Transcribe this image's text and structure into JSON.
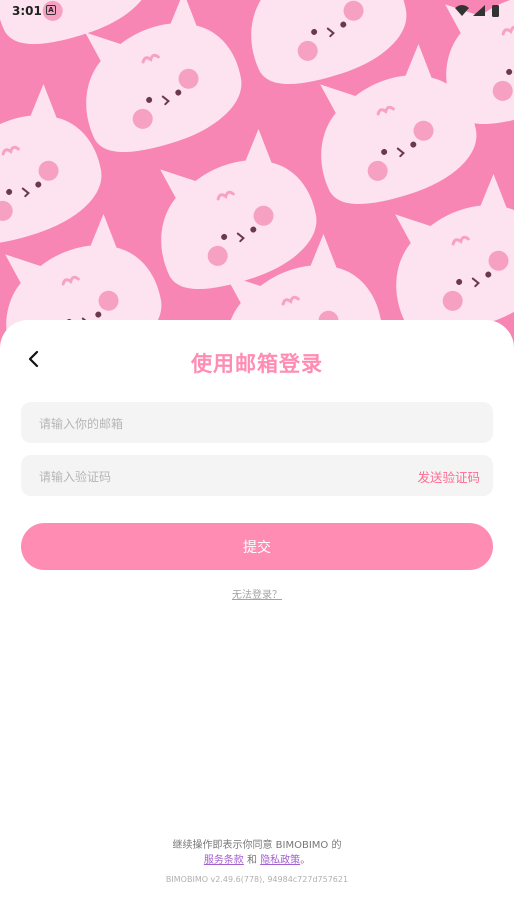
{
  "status_bar": {
    "time": "3:01",
    "notification_icon": "a-box-icon",
    "icons": [
      "wifi-icon",
      "signal-icon",
      "battery-icon"
    ]
  },
  "hero": {
    "pattern": "pink-cat-face-pattern",
    "background_color": "#f786b5",
    "cat_color": "#fde3ef",
    "cheek_color": "#f6a1c2"
  },
  "login": {
    "title": "使用邮箱登录",
    "back_icon": "chevron-left-icon",
    "email": {
      "placeholder": "请输入你的邮箱",
      "value": ""
    },
    "code": {
      "placeholder": "请输入验证码",
      "value": "",
      "send_label": "发送验证码"
    },
    "submit_label": "提交",
    "cant_login_label": "无法登录？"
  },
  "footer": {
    "agree_prefix": "继续操作即表示你同意 BIMOBIMO 的",
    "terms_label": "服务条款",
    "and_label": "和",
    "privacy_label": "隐私政策",
    "suffix": "。",
    "version": "BIMOBIMO v2.49.6(778), 94984c727d757621"
  },
  "colors": {
    "accent": "#ff8db3",
    "link": "#a45fd1",
    "send_code": "#ff6b93"
  }
}
